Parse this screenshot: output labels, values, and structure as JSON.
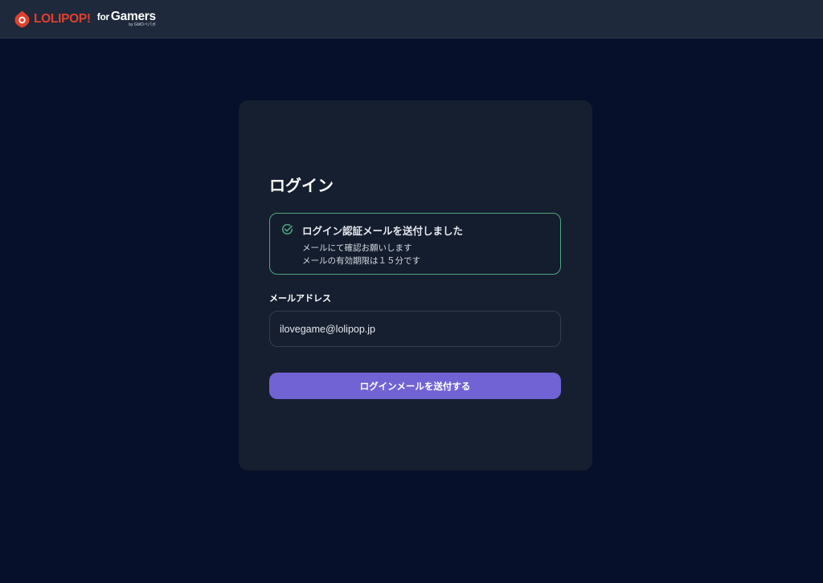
{
  "header": {
    "logo_main": "LOLIPOP!",
    "logo_for": "for",
    "logo_gamers": "Gamers",
    "logo_by": "by GMOペパボ"
  },
  "colors": {
    "background": "#06102a",
    "topbar": "#1e293b",
    "card": "#161f30",
    "accent": "#7263d4",
    "success_border": "#4fa67f",
    "brand_red": "#e0412f"
  },
  "login": {
    "title": "ログイン",
    "alert": {
      "icon": "check-circle-icon",
      "title": "ログイン認証メールを送付しました",
      "line1": "メールにて確認お願いします",
      "line2": "メールの有効期限は１５分です"
    },
    "email_label": "メールアドレス",
    "email_value": "ilovegame@lolipop.jp",
    "submit_label": "ログインメールを送付する"
  }
}
